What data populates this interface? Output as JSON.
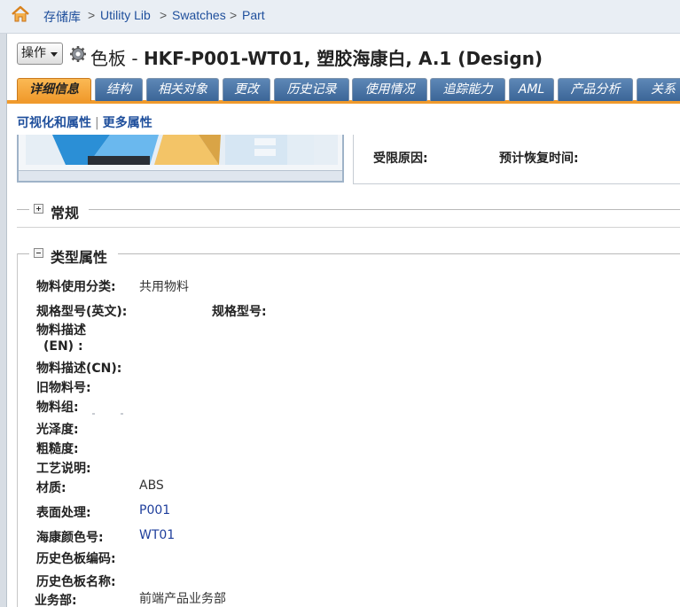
{
  "breadcrumb": [
    "存储库",
    "Utility Lib",
    "Swatches",
    "Part"
  ],
  "breadcrumb_sep": ">",
  "toolbar": {
    "ops_label": "操作"
  },
  "title": {
    "type_label": "色板",
    "dash": "-",
    "name": "HKF-P001-WT01, 塑胶海康白, A.1 (Design)"
  },
  "tabs": [
    "详细信息",
    "结构",
    "相关对象",
    "更改",
    "历史记录",
    "使用情况",
    "追踪能力",
    "AML",
    "产品分析",
    "关系"
  ],
  "active_tab": "详细信息",
  "subnav": {
    "link1": "可视化和属性",
    "link2": "更多属性"
  },
  "restriction": {
    "reason_label": "受限原因:",
    "recovery_label": "预计恢复时间:"
  },
  "sections": {
    "general": "常规",
    "type_attrs": "类型属性"
  },
  "attributes": {
    "usage_class_label": "物料使用分类:",
    "usage_class_value": "共用物料",
    "spec_en_label": "规格型号(英文):",
    "spec_label": "规格型号:",
    "desc_en_label_1": "物料描述",
    "desc_en_label_2": "(EN) :",
    "desc_cn_label": "物料描述(CN):",
    "old_code_label": "旧物料号:",
    "group_label": "物料组:",
    "gloss_label": "光泽度:",
    "rough_label": "粗糙度:",
    "process_label": "工艺说明:",
    "material_label": "材质:",
    "material_value": "ABS",
    "surface_label": "表面处理:",
    "surface_value": "P001",
    "color_label": "海康颜色号:",
    "color_value": "WT01",
    "hist_code_label": "历史色板编码:",
    "hist_name_label": "历史色板名称:",
    "bu_label": "业务部:",
    "bu_value": "前端产品业务部"
  },
  "colors": {
    "accent": "#f09a2c",
    "tab_blue": "#3b6597",
    "link": "#1f4f9c"
  }
}
